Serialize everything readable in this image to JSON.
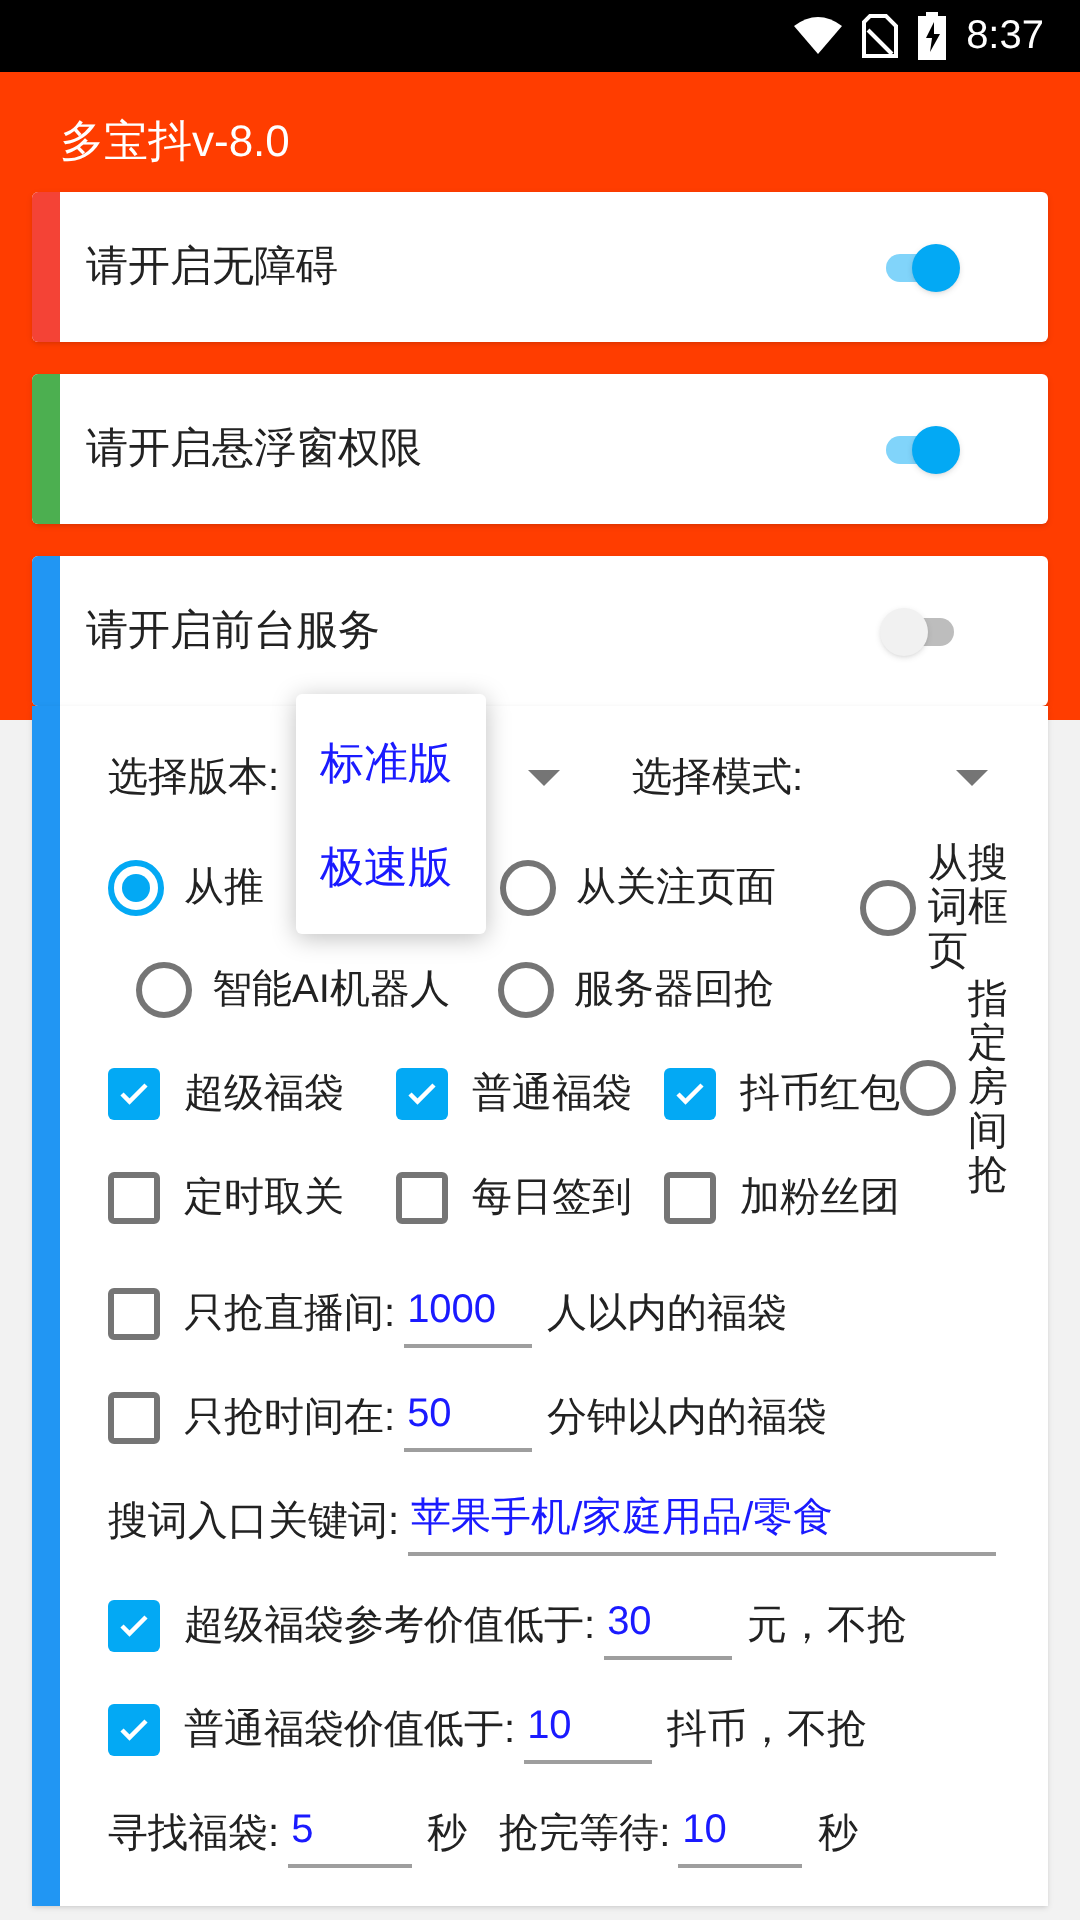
{
  "status_bar": {
    "time": "8:37"
  },
  "app_bar": {
    "title": "多宝抖v-8.0"
  },
  "permissions": [
    {
      "label": "请开启无障碍",
      "color": "#f44336",
      "on": true
    },
    {
      "label": "请开启悬浮窗权限",
      "color": "#4caf50",
      "on": true
    },
    {
      "label": "请开启前台服务",
      "color": "#2196f3",
      "on": false
    }
  ],
  "version_select": {
    "label": "选择版本:"
  },
  "mode_select": {
    "label": "选择模式:"
  },
  "version_menu": {
    "options": [
      {
        "label": "标准版"
      },
      {
        "label": "极速版"
      }
    ]
  },
  "sources": [
    {
      "label": "从推",
      "selected": true
    },
    {
      "label": "从关注页面",
      "selected": false
    },
    {
      "label": "从搜词框页",
      "selected": false
    },
    {
      "label": "智能AI机器人",
      "selected": false
    },
    {
      "label": "服务器回抢",
      "selected": false
    },
    {
      "label": "指定房间抢",
      "selected": false
    }
  ],
  "bag_types": [
    {
      "label": "超级福袋",
      "checked": true
    },
    {
      "label": "普通福袋",
      "checked": true
    },
    {
      "label": "抖币红包",
      "checked": true
    },
    {
      "label": "定时取关",
      "checked": false
    },
    {
      "label": "每日签到",
      "checked": false
    },
    {
      "label": "加粉丝团",
      "checked": false
    }
  ],
  "rows": [
    {
      "kind": "check",
      "checked": false,
      "label": "只抢直播间:",
      "value": "1000",
      "suffix": "人以内的福袋"
    },
    {
      "kind": "check",
      "checked": false,
      "label": "只抢时间在:",
      "value": "50",
      "suffix": "分钟以内的福袋"
    },
    {
      "kind": "keyword",
      "label": "搜词入口关键词:",
      "value": "苹果手机/家庭用品/零食"
    },
    {
      "kind": "check",
      "checked": true,
      "label": "超级福袋参考价值低于:",
      "value": "30",
      "suffix": "元，不抢"
    },
    {
      "kind": "check",
      "checked": true,
      "label": "普通福袋价值低于:",
      "value": "10",
      "suffix": "抖币，不抢"
    },
    {
      "kind": "pair",
      "items": [
        {
          "label": "寻找福袋:",
          "value": "5",
          "suffix": "秒"
        },
        {
          "label": "抢完等待:",
          "value": "10",
          "suffix": "秒"
        }
      ]
    }
  ]
}
